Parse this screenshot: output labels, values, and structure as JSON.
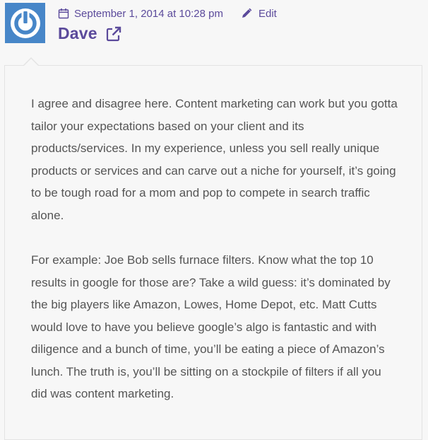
{
  "comment": {
    "avatar_icon": "power-icon",
    "date": "September 1, 2014 at 10:28 pm",
    "edit_label": "Edit",
    "author": "Dave",
    "paragraphs": [
      "I agree and disagree here. Content marketing can work but you gotta tailor your expectations based on your client and its products/services. In my experience, unless you sell really unique products or services and can carve out a niche for yourself, it’s going to be tough road for a mom and pop to compete in search traffic alone.",
      "For example: Joe Bob sells furnace filters. Know what the top 10 results in google for those are? Take a wild guess: it’s dominated by the big players like Amazon, Lowes, Home Depot, etc. Matt Cutts would love to have you believe google’s algo is fantastic and with diligence and a bunch of time, you’ll be eating a piece of Amazon’s lunch. The truth is, you’ll be sitting on a stockpile of filters if all you did was content marketing."
    ]
  },
  "colors": {
    "accent": "#5b4a9b",
    "avatar_bg": "#4786c8",
    "text": "#555555",
    "background": "#f7f7f7"
  }
}
